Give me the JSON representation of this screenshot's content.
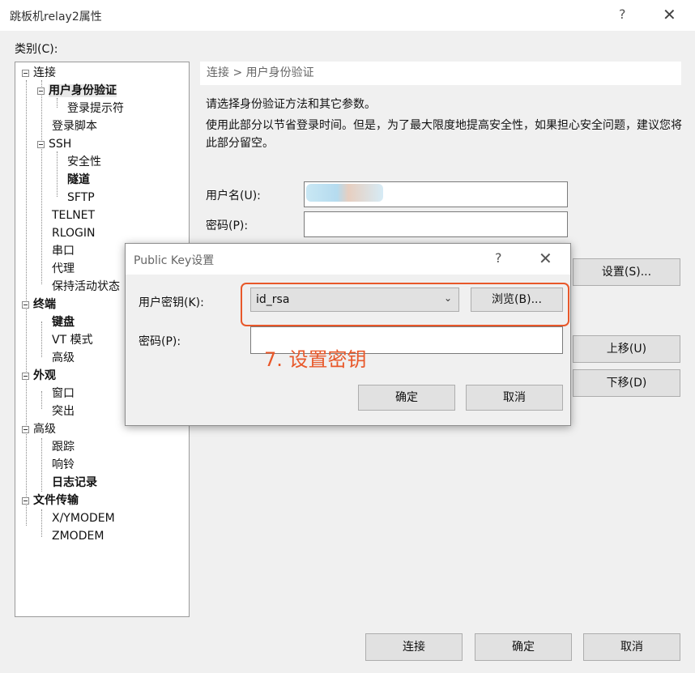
{
  "window": {
    "title": "跳板机relay2属性",
    "help": "?",
    "close": "✕"
  },
  "category_label": "类别(C):",
  "tree": [
    {
      "label": "连接",
      "bold": true,
      "expand": true
    },
    {
      "label": "用户身份验证",
      "bold": true,
      "selected": true,
      "expand": true
    },
    {
      "label": "登录提示符"
    },
    {
      "label": "登录脚本"
    },
    {
      "label": "SSH",
      "expand": true
    },
    {
      "label": "安全性"
    },
    {
      "label": "隧道",
      "bold": true
    },
    {
      "label": "SFTP"
    },
    {
      "label": "TELNET"
    },
    {
      "label": "RLOGIN"
    },
    {
      "label": "串口"
    },
    {
      "label": "代理"
    },
    {
      "label": "保持活动状态"
    },
    {
      "label": "终端",
      "bold": true,
      "expand": true
    },
    {
      "label": "键盘",
      "bold": true
    },
    {
      "label": "VT 模式"
    },
    {
      "label": "高级"
    },
    {
      "label": "外观",
      "bold": true,
      "expand": true
    },
    {
      "label": "窗口"
    },
    {
      "label": "突出"
    },
    {
      "label": "高级",
      "expand": true
    },
    {
      "label": "跟踪"
    },
    {
      "label": "响铃"
    },
    {
      "label": "日志记录",
      "bold": true
    },
    {
      "label": "文件传输",
      "bold": true,
      "expand": true
    },
    {
      "label": "X/YMODEM"
    },
    {
      "label": "ZMODEM"
    }
  ],
  "breadcrumb": "连接 > 用户身份验证",
  "desc1": "请选择身份验证方法和其它参数。",
  "desc2": "使用此部分以节省登录时间。但是，为了最大限度地提高安全性，如果担心安全问题，建议您将此部分留空。",
  "form": {
    "username_label": "用户名(U):",
    "password_label": "密码(P):",
    "settings_btn": "设置(S)...",
    "up_btn": "上移(U)",
    "down_btn": "下移(D)"
  },
  "dialog": {
    "title": "Public Key设置",
    "help": "?",
    "close": "✕",
    "key_label": "用户密钥(K):",
    "key_value": "id_rsa",
    "browse_btn": "浏览(B)...",
    "password_label": "密码(P):",
    "ok_btn": "确定",
    "cancel_btn": "取消"
  },
  "annotation": "7. 设置密钥",
  "bottom": {
    "connect": "连接",
    "ok": "确定",
    "cancel": "取消"
  },
  "colors": {
    "highlight": "#e8582a",
    "tree_bg": "#ffffff",
    "window_bg": "#f0f0f0"
  }
}
